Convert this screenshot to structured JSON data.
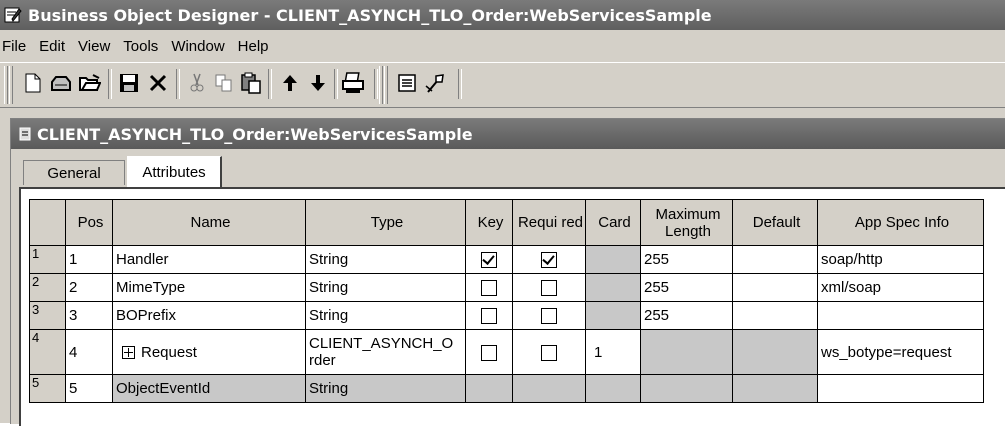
{
  "window": {
    "title": "Business Object Designer - CLIENT_ASYNCH_TLO_Order:WebServicesSample"
  },
  "menu": [
    "File",
    "Edit",
    "View",
    "Tools",
    "Window",
    "Help"
  ],
  "toolbar": {
    "icons": [
      "new-document-icon",
      "open-icon",
      "open-folder-icon",
      "save-icon",
      "delete-icon",
      "cut-icon",
      "copy-icon",
      "paste-icon",
      "move-up-icon",
      "move-down-icon",
      "print-icon",
      "properties-icon",
      "validate-icon"
    ]
  },
  "inner": {
    "title": "CLIENT_ASYNCH_TLO_Order:WebServicesSample"
  },
  "tabs": [
    {
      "label": "General"
    },
    {
      "label": "Attributes"
    }
  ],
  "grid": {
    "columns": [
      "Pos",
      "Name",
      "Type",
      "Key",
      "Requi red",
      "Card",
      "Maximum Length",
      "Default",
      "App Spec Info"
    ],
    "rows": [
      {
        "row": "1",
        "pos": "1",
        "name": "Handler",
        "type": "String",
        "key": true,
        "required": true,
        "card": "",
        "maxlen": "255",
        "default": "",
        "appspec": "soap/http"
      },
      {
        "row": "2",
        "pos": "2",
        "name": "MimeType",
        "type": "String",
        "key": false,
        "required": false,
        "card": "",
        "maxlen": "255",
        "default": "",
        "appspec": "xml/soap"
      },
      {
        "row": "3",
        "pos": "3",
        "name": "BOPrefix",
        "type": "String",
        "key": false,
        "required": false,
        "card": "",
        "maxlen": "255",
        "default": "",
        "appspec": ""
      },
      {
        "row": "4",
        "pos": "4",
        "name": "Request",
        "type": "CLIENT_ASYNCH_O rder",
        "key": false,
        "required": false,
        "card": "1",
        "maxlen": "",
        "default": "",
        "appspec": "ws_botype=request"
      },
      {
        "row": "5",
        "pos": "5",
        "name": "ObjectEventId",
        "type": "String",
        "key": null,
        "required": null,
        "card": "",
        "maxlen": "",
        "default": "",
        "appspec": ""
      }
    ]
  }
}
